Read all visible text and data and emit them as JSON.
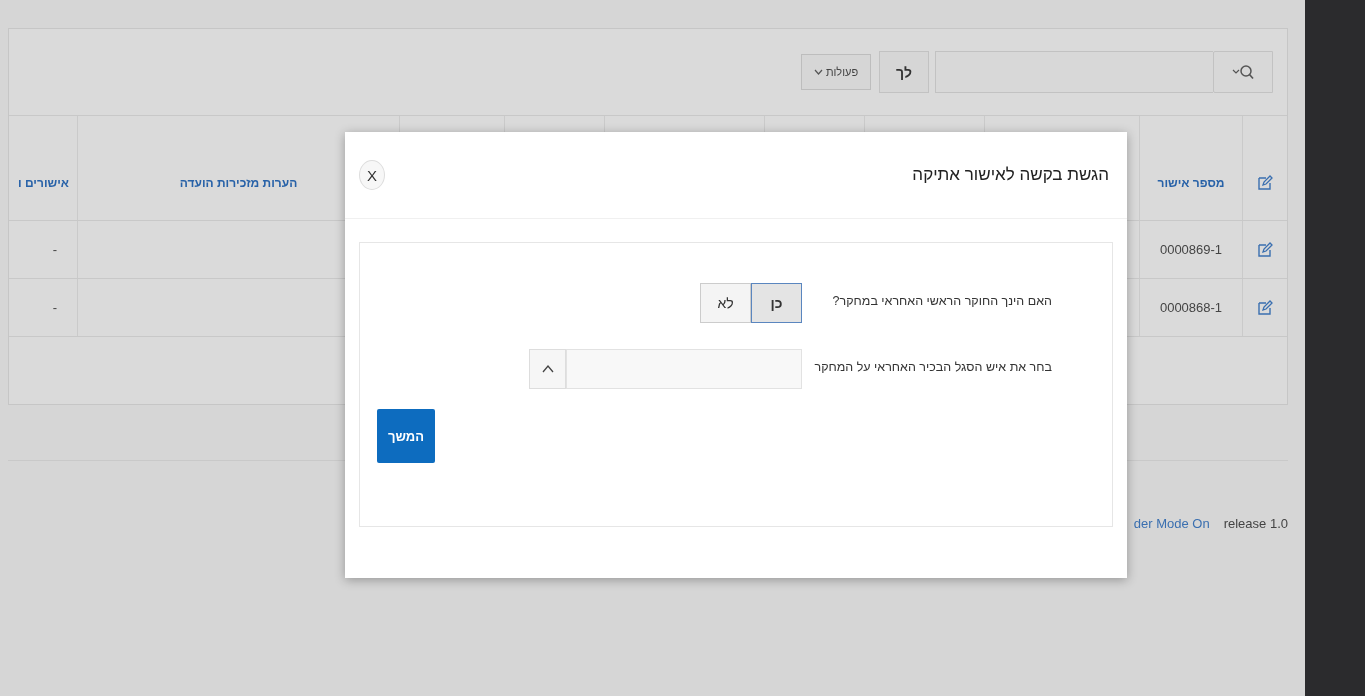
{
  "toolbar": {
    "go_button": "לך",
    "actions_button": "פעולות"
  },
  "table": {
    "columns": [
      {
        "label": "מספר אישור"
      },
      {
        "label": "הערות מזכירות הועדה"
      },
      {
        "label": "אישורים ו"
      }
    ],
    "rows": [
      {
        "number": "0000869-1",
        "last_value": "-"
      },
      {
        "number": "0000868-1",
        "last_value": "-"
      }
    ]
  },
  "footer": {
    "link": "der Mode On",
    "release": "release 1.0"
  },
  "dialog": {
    "title": "הגשת בקשה לאישור אתיקה",
    "close": "X",
    "fields": [
      {
        "kind": "toggle",
        "label": "האם הינך החוקר הראשי האחראי במחקר?",
        "options": [
          {
            "label": "כן",
            "selected": true
          },
          {
            "label": "לא",
            "selected": false
          }
        ]
      },
      {
        "kind": "select",
        "label": "בחר את איש הסגל הבכיר האחראי על המחקר"
      }
    ],
    "button": "המשך"
  }
}
